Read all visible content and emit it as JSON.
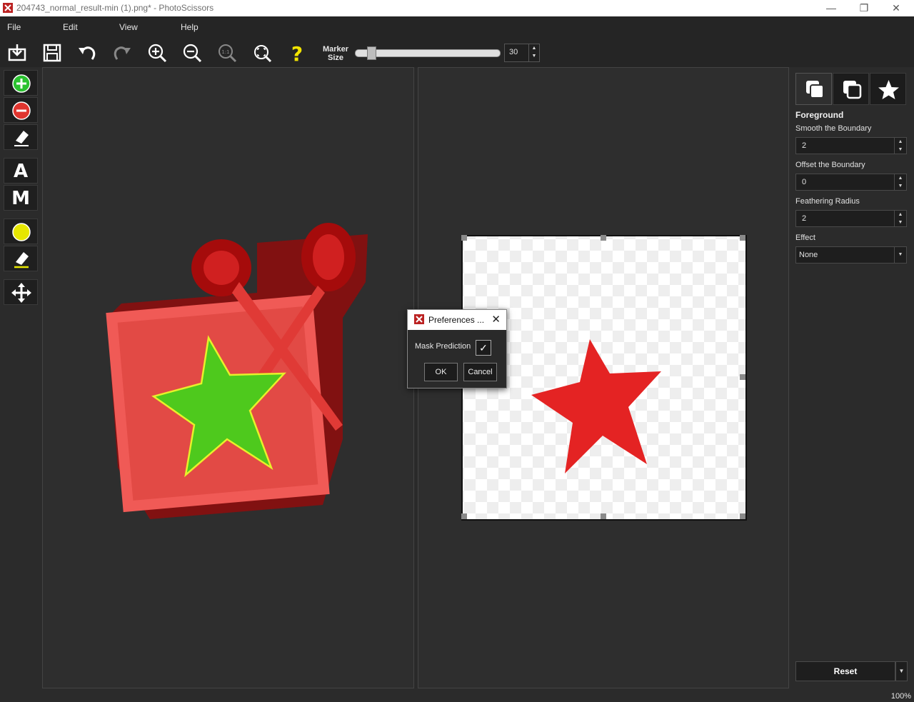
{
  "window": {
    "title": "204743_normal_result-min (1).png* - PhotoScissors",
    "minimize": "—",
    "restore": "❐",
    "close": "✕"
  },
  "menu": {
    "items": [
      "File",
      "Edit",
      "View",
      "Help"
    ]
  },
  "toolbar": {
    "icons": [
      "import-icon",
      "save-icon",
      "undo-icon",
      "redo-icon",
      "zoom-in-icon",
      "zoom-out-icon",
      "zoom-1to1-icon",
      "zoom-fit-icon",
      "help-icon"
    ],
    "marker_label_line1": "Marker",
    "marker_label_line2": "Size",
    "marker_size": "30",
    "marker_size_fraction": 0.1,
    "spin_up": "▲",
    "spin_down": "▼"
  },
  "tools": {
    "icons": [
      "foreground-marker-icon",
      "background-marker-icon",
      "eraser-icon",
      "hair-marker-icon",
      "eraser-yellow-icon",
      "move-icon"
    ],
    "letter_a": "A",
    "letter_m": "M"
  },
  "right_panel": {
    "tabs": [
      "foreground-tab-icon",
      "background-tab-icon",
      "effects-star-icon"
    ],
    "section_title": "Foreground",
    "smooth_label": "Smooth the Boundary",
    "smooth_value": "2",
    "offset_label": "Offset the Boundary",
    "offset_value": "0",
    "feather_label": "Feathering Radius",
    "feather_value": "2",
    "effect_label": "Effect",
    "effect_value": "None",
    "reset_label": "Reset",
    "dropdown_arrow": "▼"
  },
  "dialog": {
    "title": "Preferences ...",
    "close": "✕",
    "mask_prediction_label": "Mask Prediction",
    "mask_prediction_checked": "✓",
    "ok_label": "OK",
    "cancel_label": "Cancel"
  },
  "status": {
    "zoom": "100%"
  },
  "colors": {
    "accent_green": "#2bc230",
    "accent_red": "#e0352f",
    "help_yellow": "#f2e400",
    "mask_red": "#c81414",
    "mask_green": "#4ec91d"
  }
}
